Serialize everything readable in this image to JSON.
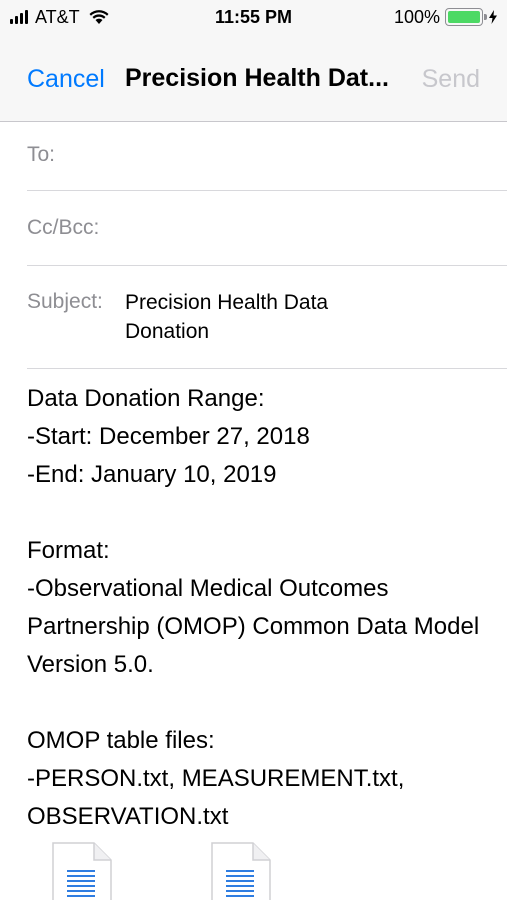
{
  "status_bar": {
    "carrier": "AT&T",
    "time": "11:55 PM",
    "battery_percent": "100%",
    "battery_color": "#4cd964",
    "icons": [
      "signal-icon",
      "wifi-icon",
      "battery-icon",
      "charging-bolt-icon"
    ]
  },
  "nav": {
    "cancel_label": "Cancel",
    "title": "Precision Health Dat...",
    "send_label": "Send",
    "accent_color": "#007aff"
  },
  "fields": {
    "to_label": "To:",
    "to_value": "",
    "cc_label": "Cc/Bcc:",
    "cc_value": "",
    "subject_label": "Subject:",
    "subject_value": "Precision Health Data Donation"
  },
  "body": {
    "range_heading": "Data Donation Range:",
    "range_start": "-Start: December 27, 2018",
    "range_end": "-End: January 10, 2019",
    "format_heading": "Format:",
    "format_text": "-Observational Medical Outcomes Partnership (OMOP) Common Data Model Version 5.0.",
    "files_heading": "OMOP table files:",
    "files_text": "-PERSON.txt, MEASUREMENT.txt, OBSERVATION.txt"
  },
  "attachments": [
    {
      "icon": "text-file-icon"
    },
    {
      "icon": "text-file-icon"
    }
  ]
}
